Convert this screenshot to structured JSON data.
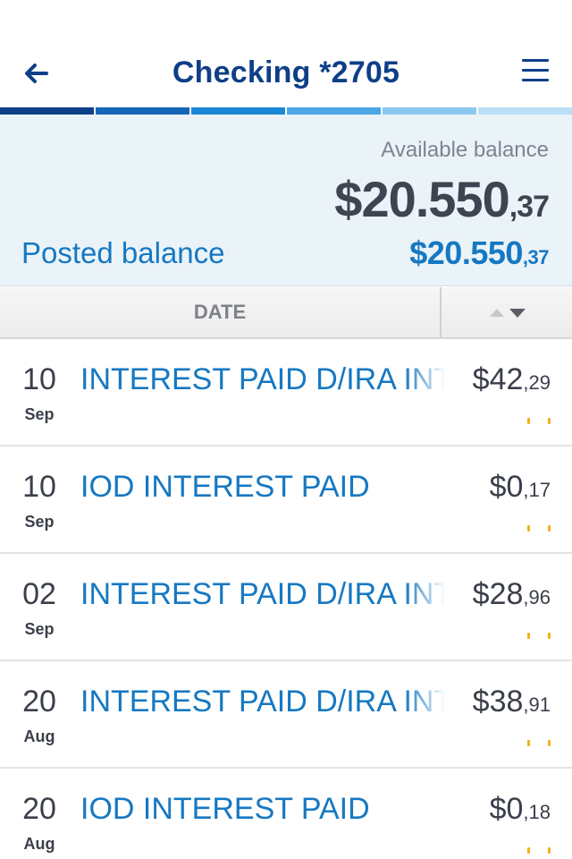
{
  "header": {
    "title": "Checking *2705",
    "back_icon": "arrow-left-icon",
    "menu_icon": "hamburger-menu-icon"
  },
  "strip_colors": [
    "#0e3f87",
    "#1565b8",
    "#1b88d6",
    "#4aa7e4",
    "#8ac8ef",
    "#b9def6"
  ],
  "colors": {
    "brand": "#0e3f87",
    "accent": "#1678c2",
    "panel_bg": "#eaf3f8",
    "flag": "#f3b21b"
  },
  "balance": {
    "available_label": "Available balance",
    "available_whole": "$20.550",
    "available_cents": ",37",
    "posted_label": "Posted balance",
    "posted_whole": "$20.550",
    "posted_cents": ",37"
  },
  "columns": {
    "date_label": "DATE",
    "sort_icon": "sort-arrows-icon"
  },
  "transactions": [
    {
      "day": "10",
      "month": "Sep",
      "description": "INTEREST PAID D/IRA INT",
      "whole": "$42",
      "cents": ",29"
    },
    {
      "day": "10",
      "month": "Sep",
      "description": "IOD INTEREST PAID",
      "whole": "$0",
      "cents": ",17"
    },
    {
      "day": "02",
      "month": "Sep",
      "description": "INTEREST PAID D/IRA INT",
      "whole": "$28",
      "cents": ",96"
    },
    {
      "day": "20",
      "month": "Aug",
      "description": "INTEREST PAID D/IRA INT",
      "whole": "$38",
      "cents": ",91"
    },
    {
      "day": "20",
      "month": "Aug",
      "description": "IOD INTEREST PAID",
      "whole": "$0",
      "cents": ",18"
    }
  ]
}
